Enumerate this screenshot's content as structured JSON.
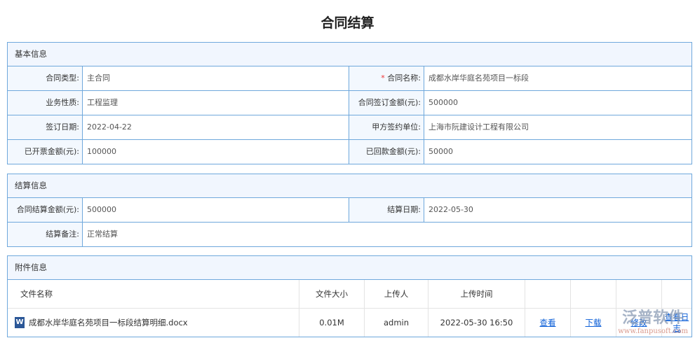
{
  "title": "合同结算",
  "basic": {
    "header": "基本信息",
    "rows": [
      [
        {
          "label": "合同类型:",
          "value": "主合同"
        },
        {
          "label": "合同名称:",
          "value": "成都水岸华庭名苑项目一标段",
          "required": true
        }
      ],
      [
        {
          "label": "业务性质:",
          "value": "工程监理"
        },
        {
          "label": "合同签订金额(元):",
          "value": "500000"
        }
      ],
      [
        {
          "label": "签订日期:",
          "value": "2022-04-22"
        },
        {
          "label": "甲方签约单位:",
          "value": "上海市阮建设计工程有限公司"
        }
      ],
      [
        {
          "label": "已开票金额(元):",
          "value": "100000"
        },
        {
          "label": "已回款金额(元):",
          "value": "50000"
        }
      ]
    ]
  },
  "settle": {
    "header": "结算信息",
    "amount_label": "合同结算金额(元):",
    "amount": "500000",
    "date_label": "结算日期:",
    "date": "2022-05-30",
    "note_label": "结算备注:",
    "note": "正常结算"
  },
  "attach": {
    "header": "附件信息",
    "columns": [
      "文件名称",
      "文件大小",
      "上传人",
      "上传时间"
    ],
    "files": [
      {
        "name": "成都水岸华庭名苑项目一标段结算明细.docx",
        "size": "0.01M",
        "uploader": "admin",
        "time": "2022-05-30 16:50",
        "actions": [
          "查看",
          "下载",
          "修改",
          "查看日志"
        ]
      }
    ]
  },
  "watermark": {
    "text": "泛普软件",
    "url": "www.fanpusoft.com"
  }
}
